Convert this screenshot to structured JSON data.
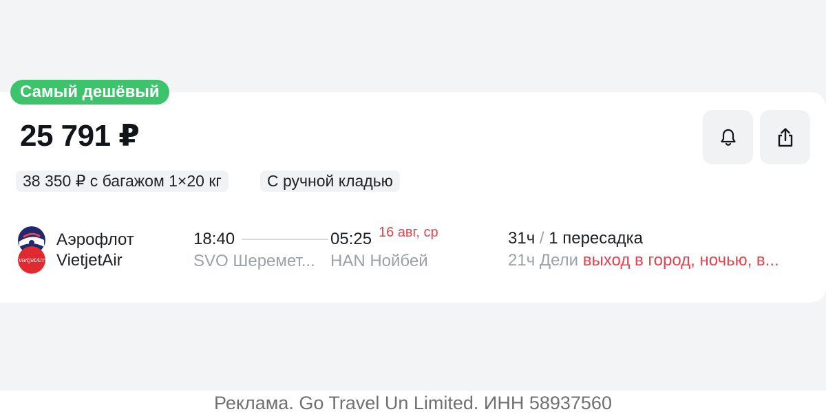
{
  "badge": {
    "label": "Самый дешёвый",
    "color": "#3cc36b"
  },
  "price": {
    "value": "25 791 ₽"
  },
  "actions": {
    "subscribe_icon": "bell-icon",
    "share_icon": "share-icon"
  },
  "options": [
    {
      "label": "38 350 ₽ с багажом 1×20 кг"
    },
    {
      "label": "С ручной кладью"
    }
  ],
  "flight": {
    "airlines": [
      {
        "name": "Аэрофлот",
        "logo_icon": "aeroflot-logo"
      },
      {
        "name": "VietjetAir",
        "logo_icon": "vietjetair-logo",
        "logo_text": "vietjetAir"
      }
    ],
    "departure": {
      "time": "18:40",
      "airport": "SVO Шеремет..."
    },
    "arrival": {
      "time": "05:25",
      "date": "16 авг, ср",
      "airport": "HAN Нойбей"
    },
    "duration": "31ч",
    "separator": "/",
    "stops": "1 пересадка",
    "layover": {
      "duration": "21ч",
      "city": "Дели",
      "note": "выход в город, ночью, в..."
    },
    "alert_color": "#e8414d"
  },
  "footer": {
    "text": "Реклама. Go Travel Un Limited. ИНН 58937560"
  }
}
